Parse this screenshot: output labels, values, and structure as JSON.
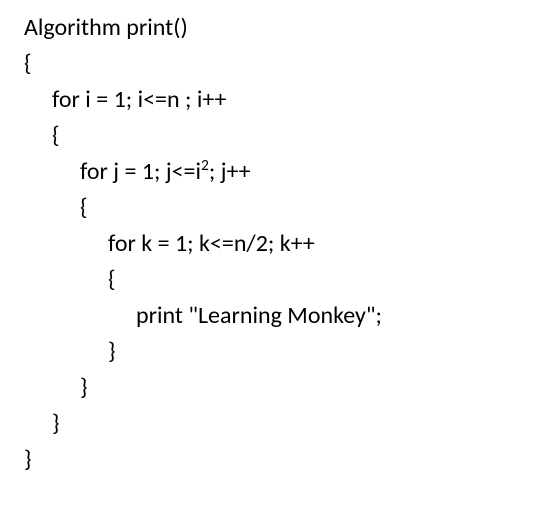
{
  "code": {
    "line1": "Algorithm print()",
    "line2": "{",
    "line3": "for i = 1; i<=n ; i++",
    "line4": "{",
    "line5_prefix": "for j = 1; j<=i",
    "line5_sup": "2",
    "line5_suffix": "; j++",
    "line6": "{",
    "line7": "for k = 1; k<=n/2; k++",
    "line8": "{",
    "line9": "print \"Learning Monkey\";",
    "line10": "}",
    "line11": "}",
    "line12": "}",
    "line13": "}"
  }
}
